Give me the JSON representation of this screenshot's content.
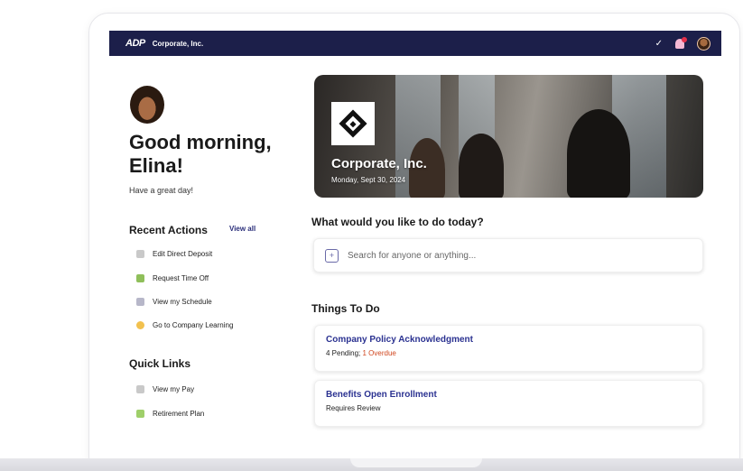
{
  "topbar": {
    "logo": "ADP",
    "company": "Corporate, Inc."
  },
  "icons": {
    "check": "check-icon",
    "bell": "bell-icon",
    "avatar": "avatar"
  },
  "greeting": {
    "title": "Good morning, Elina!",
    "subtitle": "Have a great day!"
  },
  "recent_actions": {
    "title": "Recent Actions",
    "view_all": "View all",
    "items": [
      {
        "label": "Edit Direct Deposit",
        "color": "#c9c9c9"
      },
      {
        "label": "Request Time Off",
        "color": "#8fbf5a"
      },
      {
        "label": "View my Schedule",
        "color": "#b7b7c9"
      },
      {
        "label": "Go to Company Learning",
        "color": "#f2c14e"
      }
    ]
  },
  "quick_links": {
    "title": "Quick Links",
    "items": [
      {
        "label": "View my Pay",
        "color": "#c9c9c9"
      },
      {
        "label": "Retirement Plan",
        "color": "#9fcf6a"
      }
    ]
  },
  "hero": {
    "title": "Corporate, Inc.",
    "date": "Monday, Sept 30, 2024"
  },
  "question": "What would you like to do today?",
  "search": {
    "placeholder": "Search for anyone or anything..."
  },
  "things_to_do": {
    "title": "Things To Do",
    "cards": [
      {
        "title": "Company Policy Acknowledgment",
        "pending": "4 Pending; ",
        "overdue": "1 Overdue"
      },
      {
        "title": "Benefits Open Enrollment",
        "status": "Requires Review"
      }
    ]
  }
}
